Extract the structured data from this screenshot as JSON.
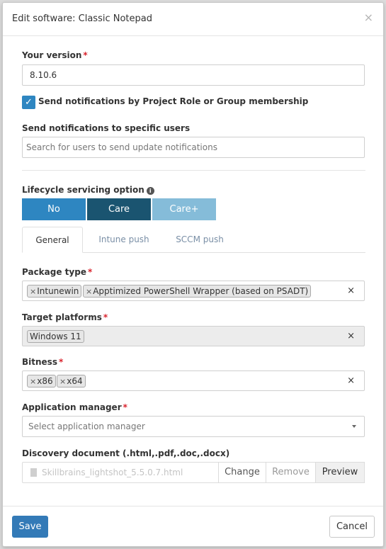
{
  "modal": {
    "title": "Edit software: Classic Notepad",
    "close_symbol": "×"
  },
  "form": {
    "version": {
      "label": "Your version",
      "required_mark": "*",
      "value": "8.10.6"
    },
    "notify_role": {
      "checked": true,
      "label": "Send notifications by Project Role or Group membership"
    },
    "notify_users": {
      "label": "Send notifications to specific users",
      "placeholder": "Search for users to send update notifications"
    },
    "lifecycle": {
      "label": "Lifecycle servicing option",
      "info_icon": "info-circle-icon",
      "options": [
        {
          "label": "No",
          "color": "#2e86c1"
        },
        {
          "label": "Care",
          "color": "#1a5470",
          "selected": true
        },
        {
          "label": "Care+",
          "color": "#85bcd9"
        }
      ]
    },
    "tabs": [
      {
        "label": "General",
        "active": true
      },
      {
        "label": "Intune push",
        "active": false
      },
      {
        "label": "SCCM push",
        "active": false
      }
    ],
    "package_type": {
      "label": "Package type",
      "required_mark": "*",
      "chips": [
        "Intunewin",
        "Apptimized PowerShell Wrapper (based on PSADT)"
      ],
      "chip_remove": "×",
      "clear": "×"
    },
    "target_platforms": {
      "label": "Target platforms",
      "required_mark": "*",
      "chips": [
        "Windows 11"
      ],
      "clear": "×"
    },
    "bitness": {
      "label": "Bitness",
      "required_mark": "*",
      "chips": [
        "x86",
        "x64"
      ],
      "chip_remove": "×",
      "clear": "×"
    },
    "app_manager": {
      "label": "Application manager",
      "required_mark": "*",
      "placeholder": "Select application manager"
    },
    "discovery": {
      "label": "Discovery document (.html,.pdf,.doc,.docx)",
      "file_name": "Skillbrains_lightshot_5.5.0.7.html",
      "buttons": {
        "change": "Change",
        "remove": "Remove",
        "preview": "Preview"
      }
    }
  },
  "footer": {
    "save": "Save",
    "cancel": "Cancel"
  },
  "colors": {
    "primary": "#337ab7",
    "required": "#d9232d",
    "checkbox": "#2e86c1"
  }
}
